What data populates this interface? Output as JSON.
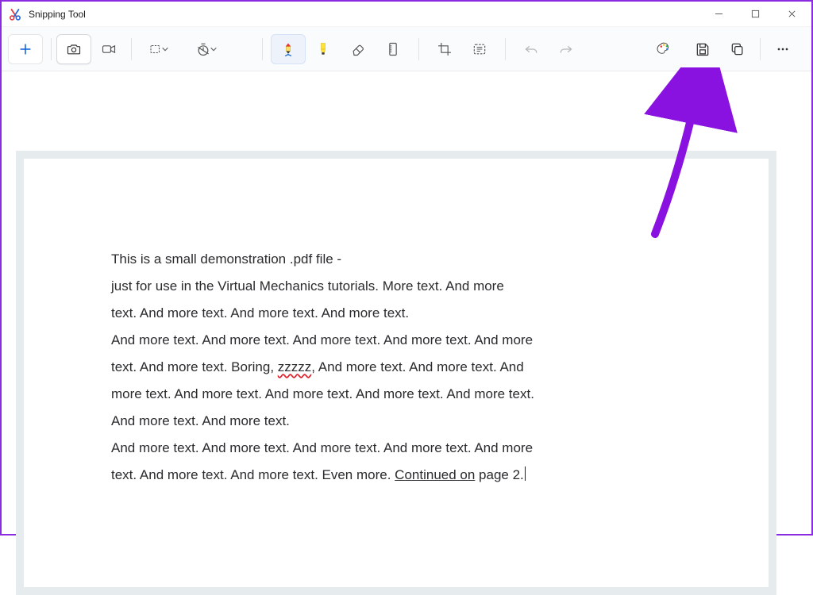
{
  "window": {
    "title": "Snipping Tool"
  },
  "document": {
    "line1": "This is a small demonstration .pdf file -",
    "line2": "just for use in the Virtual Mechanics tutorials. More text. And more",
    "line3": "text. And more text. And more text. And more text.",
    "line4": "And more text. And more text. And more text. And more text. And more",
    "line5a": "text. And more text. Boring, ",
    "spell_word": "zzzzz",
    "line5b": ", And more text. And more text. And",
    "line6": "more text. And more text. And more text. And more text. And more text.",
    "line7": "And more text. And more text.",
    "line8": "And more text. And more text. And more text. And more text. And more",
    "line9a": "text. And more text. And more text. Even more. ",
    "link_text": "Continued on",
    "line9b": " page 2."
  },
  "annotation": {
    "arrow_color": "#8a12e0"
  }
}
